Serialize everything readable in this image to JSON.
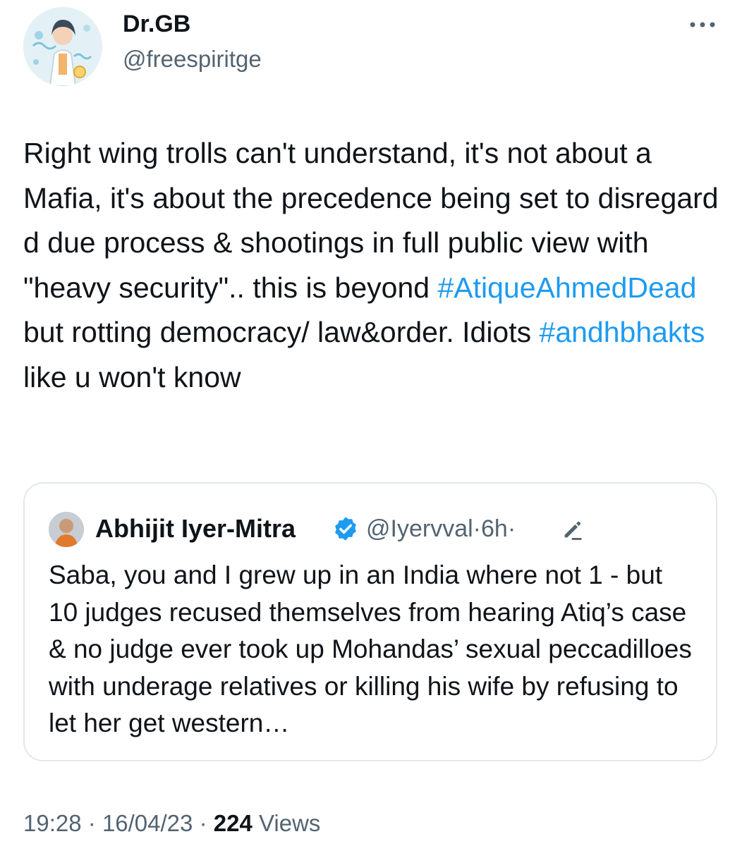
{
  "author": {
    "display_name": "Dr.GB",
    "handle": "@freespiritge",
    "avatar_icon": "scientist-avatar-icon"
  },
  "more_icon": "ellipsis-icon",
  "tweet": {
    "segments": [
      {
        "type": "text",
        "value": "Right wing trolls can't understand, it's not about a Mafia, it's about the precedence being set to disregard d due process & shootings in full public view with \"heavy security\".. this is beyond "
      },
      {
        "type": "hashtag",
        "value": "#AtiqueAhmedDead"
      },
      {
        "type": "text",
        "value": " but rotting democracy/ law&order. Idiots "
      },
      {
        "type": "hashtag",
        "value": "#andhbhakts"
      },
      {
        "type": "text",
        "value": " like u won't know"
      }
    ]
  },
  "quoted": {
    "display_name": "Abhijit Iyer-Mitra",
    "verified_icon": "verified-badge-icon",
    "handle": "@Iyervval",
    "separator": "·",
    "time": "6h",
    "edit_icon": "edited-pencil-icon",
    "text": "Saba, you and I grew up in an India where not 1 - but 10 judges recused themselves from hearing Atiq’s case & no judge ever took up Mohandas’ sexual peccadilloes with underage relatives or killing his wife by refusing to let her get western…"
  },
  "footer": {
    "time": "19:28",
    "separator": "·",
    "date": "16/04/23",
    "views_count": "224",
    "views_label": "Views"
  },
  "colors": {
    "link": "#1d9bf0",
    "secondary_text": "#536471",
    "primary_text": "#0f1419",
    "border": "#e3e8ec"
  }
}
